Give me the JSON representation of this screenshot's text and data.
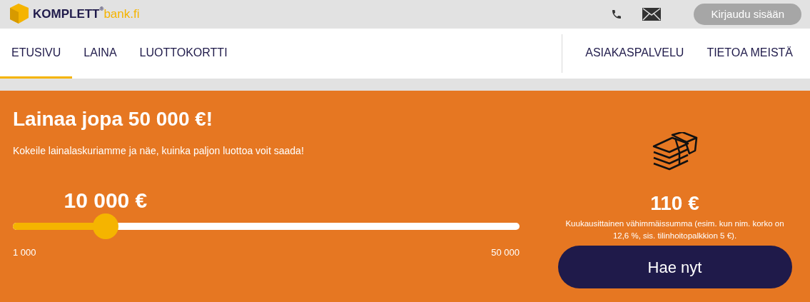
{
  "logo": {
    "brand": "KOMPLETT",
    "registered": "®",
    "domain": "bank.fi"
  },
  "header": {
    "login_button": "Kirjaudu sisään"
  },
  "nav": {
    "left": [
      {
        "label": "ETUSIVU",
        "selected": true
      },
      {
        "label": "LAINA",
        "selected": false
      },
      {
        "label": "LUOTTOKORTTI",
        "selected": false
      }
    ],
    "right": [
      {
        "label": "ASIAKASPALVELU",
        "selected": false
      },
      {
        "label": "TIETOA MEISTÄ",
        "selected": false
      }
    ]
  },
  "hero": {
    "title": "Lainaa jopa 50 000 €!",
    "subtitle": "Kokeile lainalaskuriamme ja näe, kuinka paljon luottoa voit saada!",
    "slider": {
      "value": "10 000 €",
      "level": 0.183,
      "min": "1 000",
      "max": "50 000"
    },
    "monthly_amount": "110 €",
    "monthly_note": "Kuukausittainen vähimmäissumma (esim. kun nim. korko on 12,6 %, sis. tilinhoitopalkkion 5 €).",
    "apply_button": "Hae nyt"
  }
}
